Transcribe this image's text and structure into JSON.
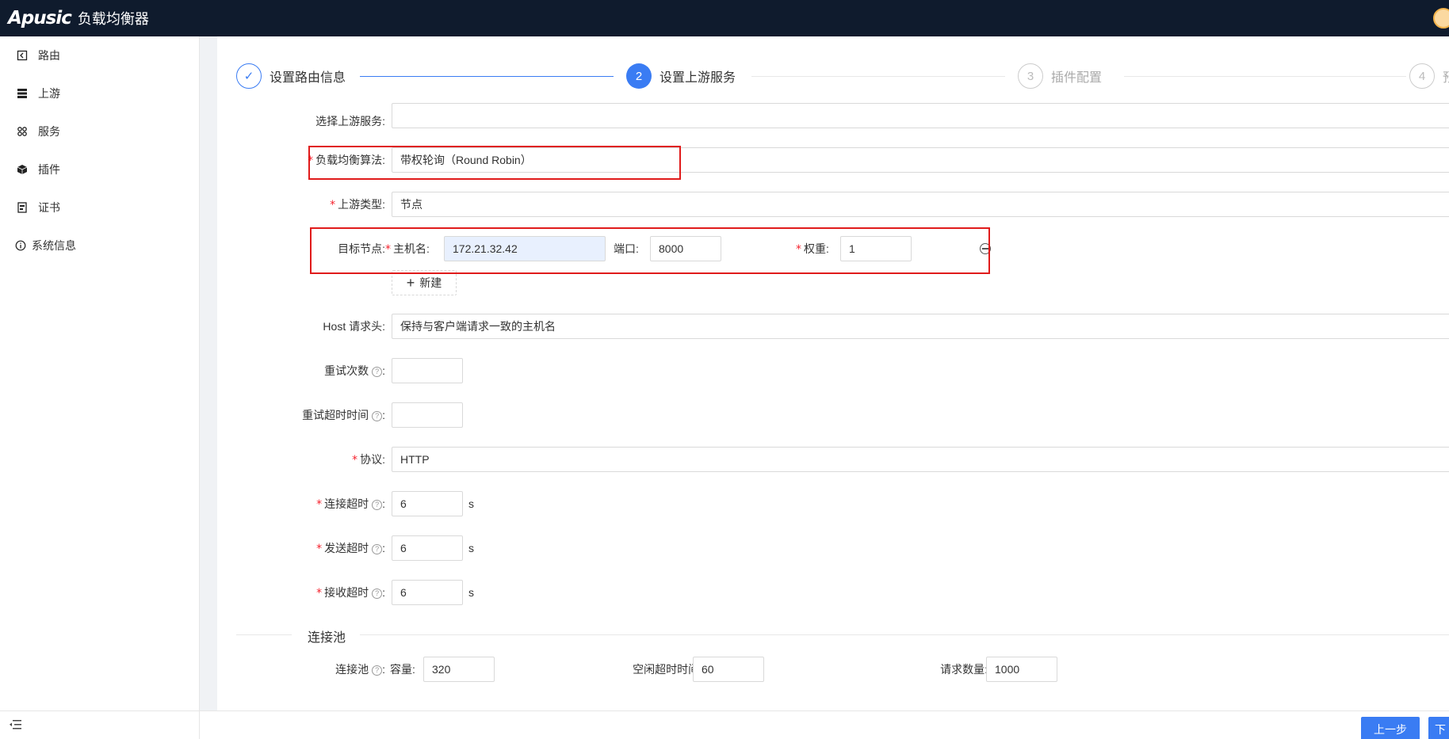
{
  "app": {
    "logo": "Apusic",
    "title": "负载均衡器"
  },
  "sidebar": {
    "items": [
      {
        "label": "路由",
        "icon": "route-icon"
      },
      {
        "label": "上游",
        "icon": "server-icon"
      },
      {
        "label": "服务",
        "icon": "service-icon"
      },
      {
        "label": "插件",
        "icon": "plugin-icon"
      },
      {
        "label": "证书",
        "icon": "certificate-icon"
      },
      {
        "label": "系统信息",
        "icon": "info-icon"
      }
    ]
  },
  "steps": [
    {
      "marker": "✓",
      "title": "设置路由信息",
      "status": "done"
    },
    {
      "marker": "2",
      "title": "设置上游服务",
      "status": "active"
    },
    {
      "marker": "3",
      "title": "插件配置",
      "status": "wait"
    },
    {
      "marker": "4",
      "title": "预",
      "status": "wait"
    }
  ],
  "form": {
    "upstream_select": {
      "label": "选择上游服务:",
      "value": ""
    },
    "lb_algorithm": {
      "label": "负载均衡算法:",
      "value": "带权轮询（Round Robin）"
    },
    "upstream_type": {
      "label": "上游类型:",
      "value": "节点"
    },
    "target_nodes": {
      "label": "目标节点:",
      "host_label": "主机名:",
      "host_value": "172.21.32.42",
      "port_label": "端口:",
      "port_value": "8000",
      "weight_label": "权重:",
      "weight_value": "1",
      "add_label": "新建"
    },
    "host_header": {
      "label": "Host 请求头:",
      "value": "保持与客户端请求一致的主机名"
    },
    "retries": {
      "label": "重试次数",
      "value": ""
    },
    "retry_timeout": {
      "label": "重试超时时间",
      "value": ""
    },
    "protocol": {
      "label": "协议:",
      "value": "HTTP"
    },
    "connect_timeout": {
      "label": "连接超时",
      "value": "6",
      "unit": "s"
    },
    "send_timeout": {
      "label": "发送超时",
      "value": "6",
      "unit": "s"
    },
    "read_timeout": {
      "label": "接收超时",
      "value": "6",
      "unit": "s"
    }
  },
  "pool": {
    "section_title": "连接池",
    "label": "连接池",
    "capacity_label": "容量:",
    "capacity_value": "320",
    "idle_timeout_label": "空闲超时时间:",
    "idle_timeout_value": "60",
    "requests_label": "请求数量:",
    "requests_value": "1000"
  },
  "footer": {
    "prev_label": "上一步",
    "next_label": "下"
  },
  "colors": {
    "primary": "#3a7cf3",
    "topbar": "#0f1b2d",
    "highlight": "#e01b1b",
    "required": "#f5222d"
  }
}
